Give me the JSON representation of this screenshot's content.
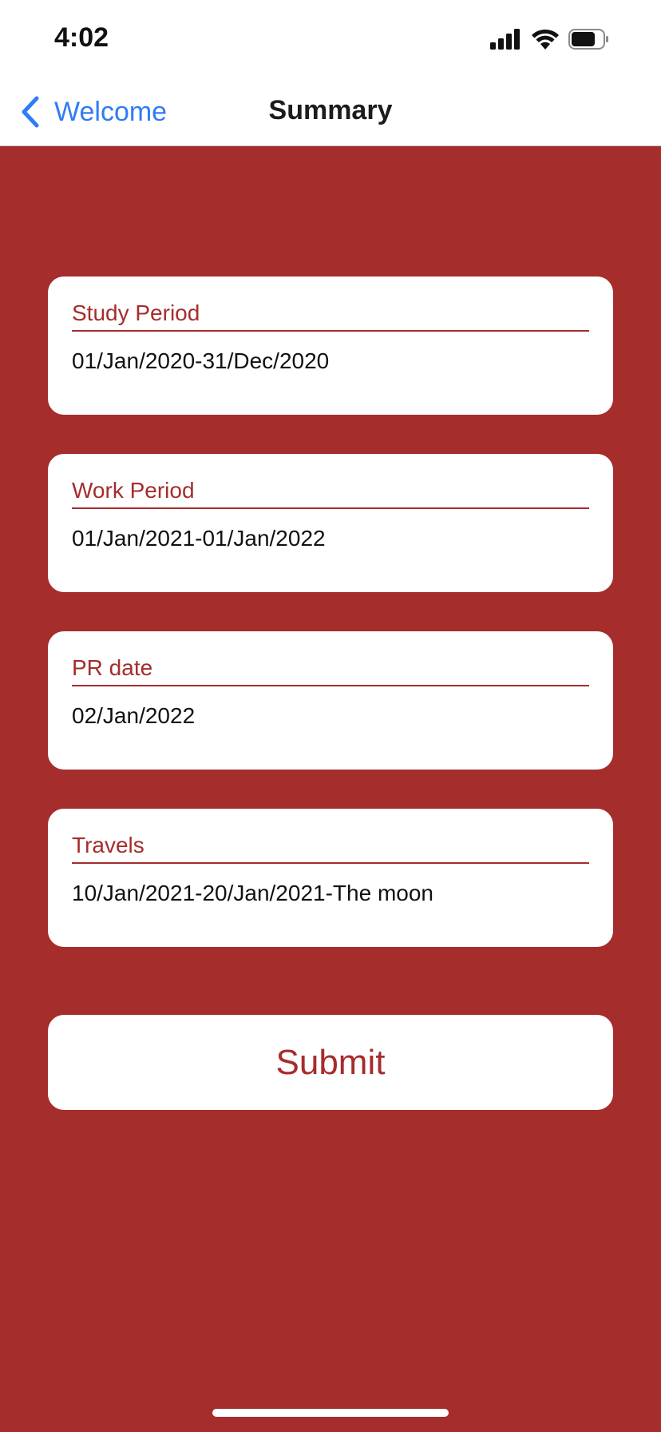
{
  "status_bar": {
    "time": "4:02",
    "signal_icon": "cellular-signal-icon",
    "wifi_icon": "wifi-icon",
    "battery_icon": "battery-icon"
  },
  "nav": {
    "back_label": "Welcome",
    "back_icon": "chevron-left-icon",
    "title": "Summary",
    "accent_color": "#2f7cf6"
  },
  "theme": {
    "background_color": "#a52d2c",
    "card_color": "#ffffff"
  },
  "fields": [
    {
      "label": "Study Period",
      "value": "01/Jan/2020-31/Dec/2020"
    },
    {
      "label": "Work Period",
      "value": "01/Jan/2021-01/Jan/2022"
    },
    {
      "label": "PR date",
      "value": "02/Jan/2022"
    },
    {
      "label": "Travels",
      "value": "10/Jan/2021-20/Jan/2021-The moon"
    }
  ],
  "submit": {
    "label": "Submit"
  }
}
